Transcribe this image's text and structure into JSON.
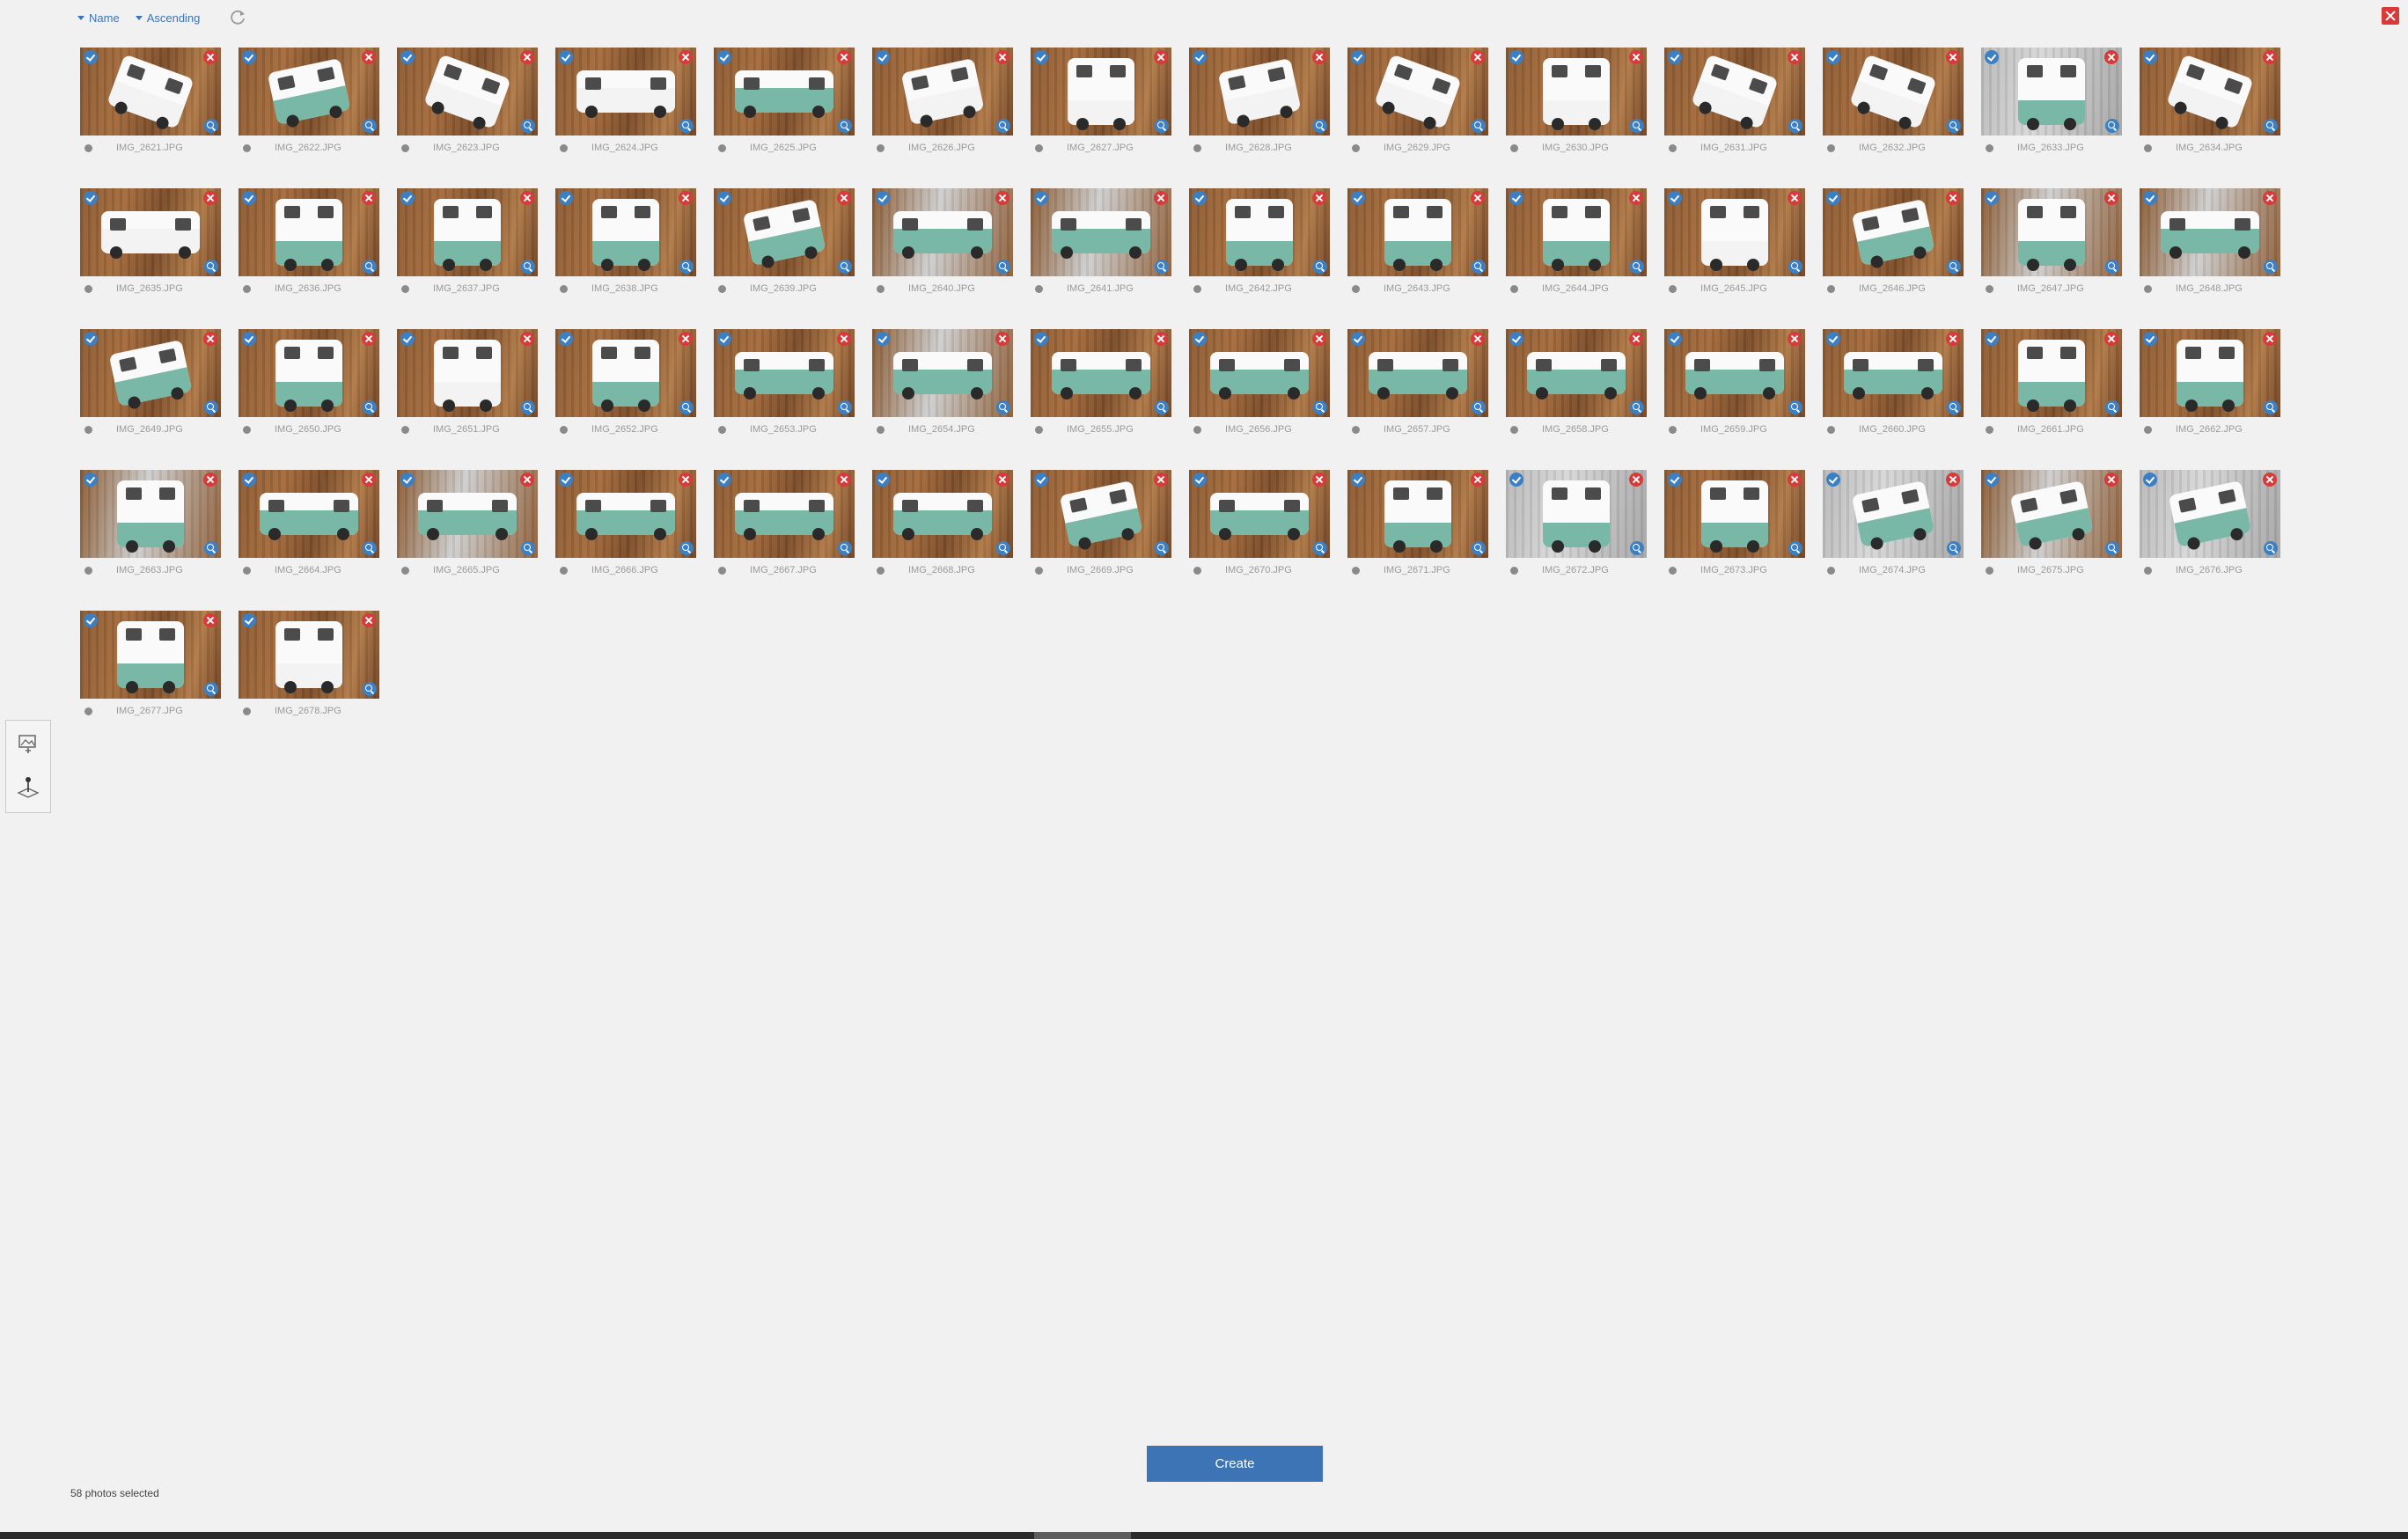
{
  "toolbar": {
    "sort_field": "Name",
    "sort_order": "Ascending",
    "refresh_icon": "refresh-icon",
    "close_icon": "close-icon",
    "accent": "#3a76b8",
    "danger": "#d83a3a"
  },
  "photos": [
    {
      "name": "IMG_2621.JPG",
      "selected": true,
      "variant": "v-top v-white"
    },
    {
      "name": "IMG_2622.JPG",
      "selected": true,
      "variant": "v-angle"
    },
    {
      "name": "IMG_2623.JPG",
      "selected": true,
      "variant": "v-top v-white"
    },
    {
      "name": "IMG_2624.JPG",
      "selected": true,
      "variant": "v-side v-white"
    },
    {
      "name": "IMG_2625.JPG",
      "selected": true,
      "variant": "v-side"
    },
    {
      "name": "IMG_2626.JPG",
      "selected": true,
      "variant": "v-angle v-white"
    },
    {
      "name": "IMG_2627.JPG",
      "selected": true,
      "variant": "v-front v-white"
    },
    {
      "name": "IMG_2628.JPG",
      "selected": true,
      "variant": "v-angle v-white"
    },
    {
      "name": "IMG_2629.JPG",
      "selected": true,
      "variant": "v-top v-white"
    },
    {
      "name": "IMG_2630.JPG",
      "selected": true,
      "variant": "v-front v-white"
    },
    {
      "name": "IMG_2631.JPG",
      "selected": true,
      "variant": "v-top v-white"
    },
    {
      "name": "IMG_2632.JPG",
      "selected": true,
      "variant": "v-top v-white"
    },
    {
      "name": "IMG_2633.JPG",
      "selected": true,
      "variant": "v-front bg-white"
    },
    {
      "name": "IMG_2634.JPG",
      "selected": true,
      "variant": "v-top v-white"
    },
    {
      "name": "IMG_2635.JPG",
      "selected": true,
      "variant": "v-side v-white"
    },
    {
      "name": "IMG_2636.JPG",
      "selected": true,
      "variant": "v-front"
    },
    {
      "name": "IMG_2637.JPG",
      "selected": true,
      "variant": "v-front"
    },
    {
      "name": "IMG_2638.JPG",
      "selected": true,
      "variant": "v-front"
    },
    {
      "name": "IMG_2639.JPG",
      "selected": true,
      "variant": "v-angle"
    },
    {
      "name": "IMG_2640.JPG",
      "selected": true,
      "variant": "v-side bg-mix"
    },
    {
      "name": "IMG_2641.JPG",
      "selected": true,
      "variant": "v-side bg-mix"
    },
    {
      "name": "IMG_2642.JPG",
      "selected": true,
      "variant": "v-front"
    },
    {
      "name": "IMG_2643.JPG",
      "selected": true,
      "variant": "v-front"
    },
    {
      "name": "IMG_2644.JPG",
      "selected": true,
      "variant": "v-front"
    },
    {
      "name": "IMG_2645.JPG",
      "selected": true,
      "variant": "v-front v-white"
    },
    {
      "name": "IMG_2646.JPG",
      "selected": true,
      "variant": "v-angle"
    },
    {
      "name": "IMG_2647.JPG",
      "selected": true,
      "variant": "v-front bg-mix"
    },
    {
      "name": "IMG_2648.JPG",
      "selected": true,
      "variant": "v-side bg-mix"
    },
    {
      "name": "IMG_2649.JPG",
      "selected": true,
      "variant": "v-angle"
    },
    {
      "name": "IMG_2650.JPG",
      "selected": true,
      "variant": "v-front"
    },
    {
      "name": "IMG_2651.JPG",
      "selected": true,
      "variant": "v-front v-white"
    },
    {
      "name": "IMG_2652.JPG",
      "selected": true,
      "variant": "v-front"
    },
    {
      "name": "IMG_2653.JPG",
      "selected": true,
      "variant": "v-side"
    },
    {
      "name": "IMG_2654.JPG",
      "selected": true,
      "variant": "v-side bg-mix"
    },
    {
      "name": "IMG_2655.JPG",
      "selected": true,
      "variant": "v-side"
    },
    {
      "name": "IMG_2656.JPG",
      "selected": true,
      "variant": "v-side"
    },
    {
      "name": "IMG_2657.JPG",
      "selected": true,
      "variant": "v-side"
    },
    {
      "name": "IMG_2658.JPG",
      "selected": true,
      "variant": "v-side"
    },
    {
      "name": "IMG_2659.JPG",
      "selected": true,
      "variant": "v-side"
    },
    {
      "name": "IMG_2660.JPG",
      "selected": true,
      "variant": "v-side"
    },
    {
      "name": "IMG_2661.JPG",
      "selected": true,
      "variant": "v-front"
    },
    {
      "name": "IMG_2662.JPG",
      "selected": true,
      "variant": "v-front"
    },
    {
      "name": "IMG_2663.JPG",
      "selected": true,
      "variant": "v-front bg-mix"
    },
    {
      "name": "IMG_2664.JPG",
      "selected": true,
      "variant": "v-side"
    },
    {
      "name": "IMG_2665.JPG",
      "selected": true,
      "variant": "v-side bg-mix"
    },
    {
      "name": "IMG_2666.JPG",
      "selected": true,
      "variant": "v-side"
    },
    {
      "name": "IMG_2667.JPG",
      "selected": true,
      "variant": "v-side"
    },
    {
      "name": "IMG_2668.JPG",
      "selected": true,
      "variant": "v-side"
    },
    {
      "name": "IMG_2669.JPG",
      "selected": true,
      "variant": "v-angle"
    },
    {
      "name": "IMG_2670.JPG",
      "selected": true,
      "variant": "v-side"
    },
    {
      "name": "IMG_2671.JPG",
      "selected": true,
      "variant": "v-front"
    },
    {
      "name": "IMG_2672.JPG",
      "selected": true,
      "variant": "v-front bg-white"
    },
    {
      "name": "IMG_2673.JPG",
      "selected": true,
      "variant": "v-front"
    },
    {
      "name": "IMG_2674.JPG",
      "selected": true,
      "variant": "v-angle bg-white"
    },
    {
      "name": "IMG_2675.JPG",
      "selected": true,
      "variant": "v-angle bg-mix"
    },
    {
      "name": "IMG_2676.JPG",
      "selected": true,
      "variant": "v-angle bg-white"
    },
    {
      "name": "IMG_2677.JPG",
      "selected": true,
      "variant": "v-front"
    },
    {
      "name": "IMG_2678.JPG",
      "selected": true,
      "variant": "v-front v-white"
    }
  ],
  "side_tools": [
    {
      "icon": "add-photo-icon"
    },
    {
      "icon": "pin-on-plane-icon"
    }
  ],
  "footer": {
    "create_label": "Create",
    "status_text": "58 photos selected"
  }
}
